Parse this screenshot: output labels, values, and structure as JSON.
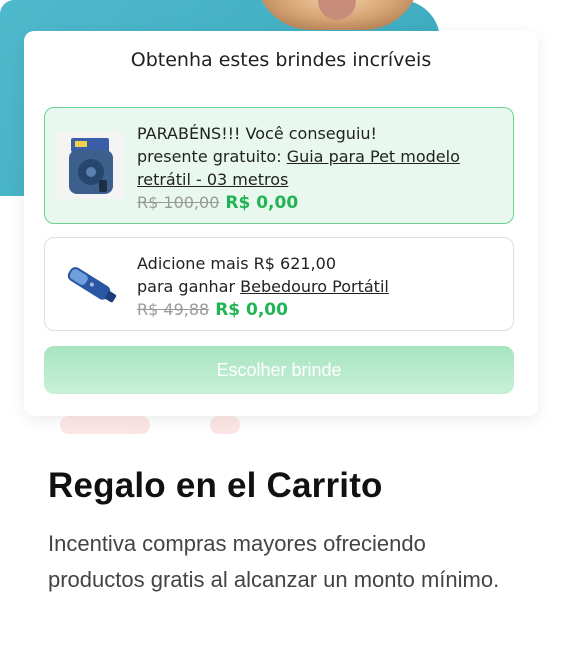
{
  "widget": {
    "title": "Obtenha estes brindes incríveis",
    "offers": [
      {
        "line1": "PARABÉNS!!! Você conseguiu!",
        "line2_prefix": "presente gratuito: ",
        "product_link": "Guia para Pet modelo retrátil - 03 metros",
        "old_price": "R$ 100,00",
        "new_price": "R$ 0,00",
        "thumbnail_icon": "retractable-leash-icon",
        "status": "unlocked"
      },
      {
        "line1": "Adicione mais R$ 621,00",
        "line2_prefix": "para ganhar ",
        "product_link": "Bebedouro Portátil",
        "old_price": "R$ 49,88",
        "new_price": "R$ 0,00",
        "thumbnail_icon": "portable-water-bottle-icon",
        "status": "locked"
      }
    ],
    "cta_label": "Escolher brinde"
  },
  "feature": {
    "heading": "Regalo en el Carrito",
    "description": "Incentiva compras mayores ofreciendo productos gratis al alcanzar un monto mínimo."
  },
  "colors": {
    "teal_background": "#3aa8bd",
    "success_green": "#22b454",
    "unlocked_border": "#6bd394",
    "unlocked_bg": "#e8f8ee",
    "cta_bg": "#a6e4bf"
  }
}
